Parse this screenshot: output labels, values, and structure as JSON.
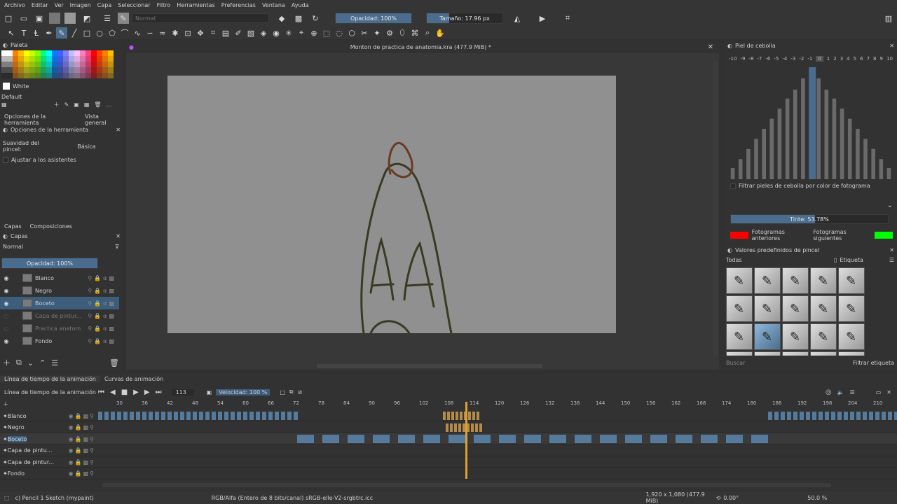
{
  "menu": [
    "Archivo",
    "Editar",
    "Ver",
    "Imagen",
    "Capa",
    "Seleccionar",
    "Filtro",
    "Herramientas",
    "Preferencias",
    "Ventana",
    "Ayuda"
  ],
  "toolbar": {
    "blend_mode": "Normal",
    "opacity": "Opacidad: 100%",
    "opacity_value": 100,
    "size": "Tamaño: 17.96 px",
    "size_fraction": 0.3
  },
  "palette": {
    "title": "Paleta",
    "color_name": "White",
    "set_name": "Default",
    "swatch_colors": [
      "#ff0000",
      "#ff4000",
      "#ff8000",
      "#ffbf00",
      "#ffff00",
      "#c0ff00",
      "#80ff00",
      "#00ff80",
      "#00ffff",
      "#0080ff",
      "#4060ff",
      "#8080ff",
      "#c0c0ff",
      "#ffc0ff",
      "#ff80c0",
      "#ff4080"
    ]
  },
  "tool_options": {
    "tabs": [
      "Opciones de la herramienta",
      "Vista general"
    ],
    "title": "Opciones de la herramienta",
    "smoothing_label": "Suavidad del pincel:",
    "smoothing_value": "Básica",
    "assistants_label": "Ajustar a los asistentes"
  },
  "layers": {
    "tabs": [
      "Capas",
      "Composiciones"
    ],
    "title": "Capas",
    "blend_mode": "Normal",
    "opacity": "Opacidad:  100%",
    "items": [
      {
        "name": "Blanco",
        "visible": true,
        "selected": false
      },
      {
        "name": "Negro",
        "visible": true,
        "selected": false
      },
      {
        "name": "Boceto",
        "visible": true,
        "selected": true
      },
      {
        "name": "Capa de pintur...",
        "visible": false,
        "selected": false
      },
      {
        "name": "Practica anatomia ...",
        "visible": false,
        "selected": false
      },
      {
        "name": "Fondo",
        "visible": true,
        "selected": false
      }
    ]
  },
  "canvas": {
    "title": "Monton de practica de anatomia.kra (477.9 MiB) *"
  },
  "onion_skin": {
    "title": "Piel de cebolla",
    "frame_labels": [
      "-10",
      "-9",
      "-8",
      "-7",
      "-6",
      "-5",
      "-4",
      "-3",
      "-2",
      "-1",
      "0",
      "1",
      "2",
      "3",
      "4",
      "5",
      "6",
      "7",
      "8",
      "9",
      "10"
    ],
    "opacity_levels": [
      0.1,
      0.18,
      0.27,
      0.36,
      0.45,
      0.54,
      0.63,
      0.72,
      0.8,
      0.9,
      1.0,
      0.9,
      0.8,
      0.72,
      0.63,
      0.54,
      0.45,
      0.36,
      0.27,
      0.18,
      0.1
    ],
    "filter_label": "Filtrar pieles de cebolla por color de fotograma",
    "tint": "Tinte: 53.78%",
    "tint_value": 53.78,
    "prev_label": "Fotogramas anteriores",
    "next_label": "Fotogramas siguientes",
    "prev_color": "#ff0000",
    "next_color": "#00ff00"
  },
  "brush_presets": {
    "title": "Valores predefinidos de pincel",
    "filter": "Todas",
    "tag_label": "Etiqueta",
    "search_placeholder": "Buscar",
    "filter_tag_label": "Filtrar etiqueta"
  },
  "timeline": {
    "tabs": [
      "Línea de tiempo de la animación",
      "Curvas de animación"
    ],
    "title": "Línea de tiempo de la animación",
    "current_frame": "113",
    "speed": "Velocidad: 100 %",
    "ruler": [
      "30",
      "36",
      "42",
      "48",
      "54",
      "60",
      "66",
      "72",
      "78",
      "84",
      "90",
      "96",
      "102",
      "108",
      "114",
      "120",
      "126",
      "132",
      "138",
      "144",
      "150",
      "156",
      "162",
      "168",
      "174",
      "180",
      "186",
      "192",
      "198",
      "204",
      "210"
    ],
    "layers": [
      "Blanco",
      "Negro",
      "Boceto",
      "Capa de pintu...",
      "Capa de pintur...",
      "Fondo"
    ]
  },
  "status": {
    "tool": "c) Pencil 1 Sketch (mypaint)",
    "color_space": "RGB/Alfa (Entero de 8 bits/canal)  sRGB-elle-V2-srgbtrc.icc",
    "dimensions": "1,920 x 1,080 (477.9 MiB)",
    "rotation": "0.00°",
    "zoom": "50.0 %"
  }
}
